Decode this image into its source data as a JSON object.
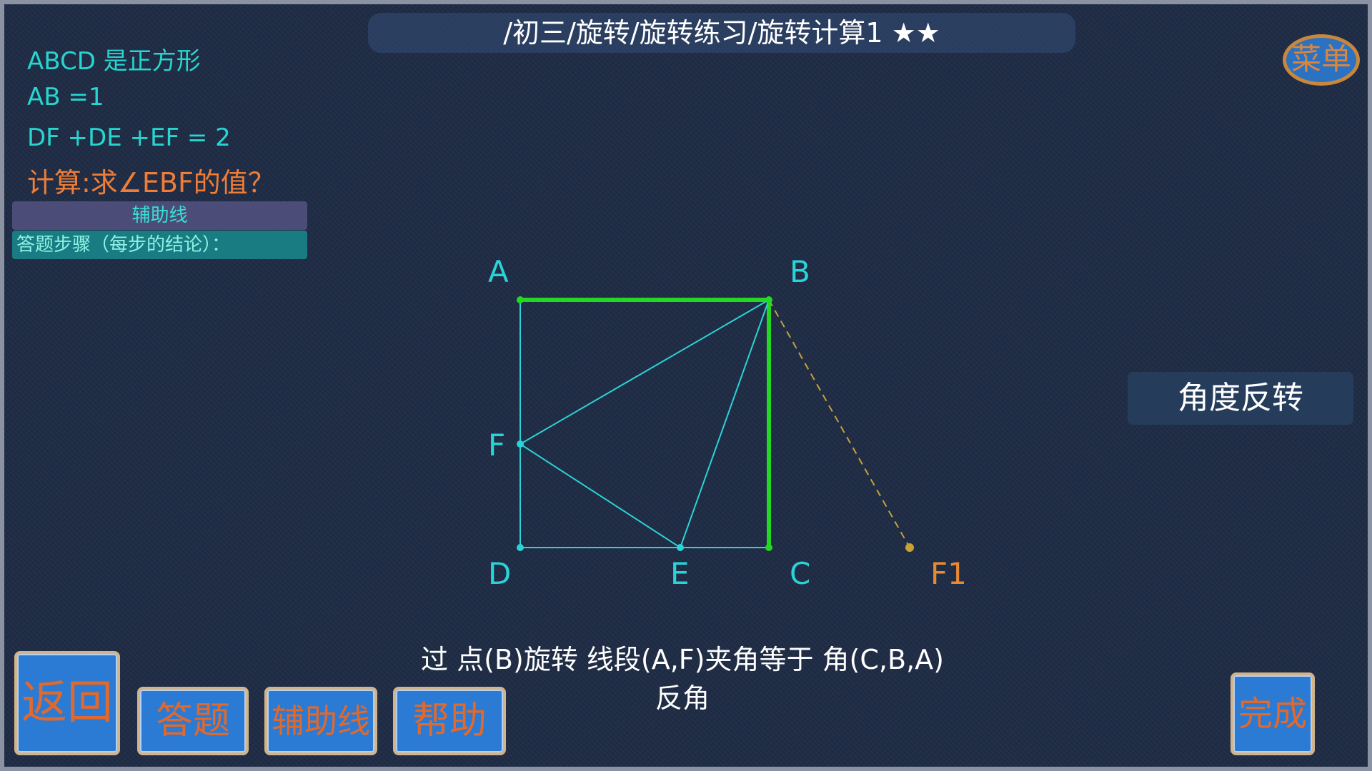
{
  "header": {
    "breadcrumb": "/初三/旋转/旋转练习/旋转计算1 ★★"
  },
  "menu_label": "菜单",
  "problem": {
    "given": [
      "ABCD 是正方形",
      "AB =1",
      "DF +DE +EF  = 2"
    ],
    "question": "计算:求∠EBF的值？",
    "aux_line_label": "辅助线",
    "steps_label": "答题步骤（每步的结论）："
  },
  "diagram": {
    "points": {
      "A": "A",
      "B": "B",
      "C": "C",
      "D": "D",
      "E": "E",
      "F": "F",
      "F1": "F1"
    },
    "colors": {
      "square_highlight": "#22d820",
      "lines": "#2ad3d6",
      "dashed": "#c9a236",
      "label": "#2ad3d6",
      "f1_label": "#e88a34"
    }
  },
  "angle_flip_label": "角度反转",
  "hint": {
    "line1": "过 点(B)旋转 线段(A,F)夹角等于 角(C,B,A)",
    "line2": "反角"
  },
  "bottom_buttons": {
    "back": "返回",
    "answer": "答题",
    "aux": "辅助线",
    "help": "帮助",
    "done": "完成"
  }
}
